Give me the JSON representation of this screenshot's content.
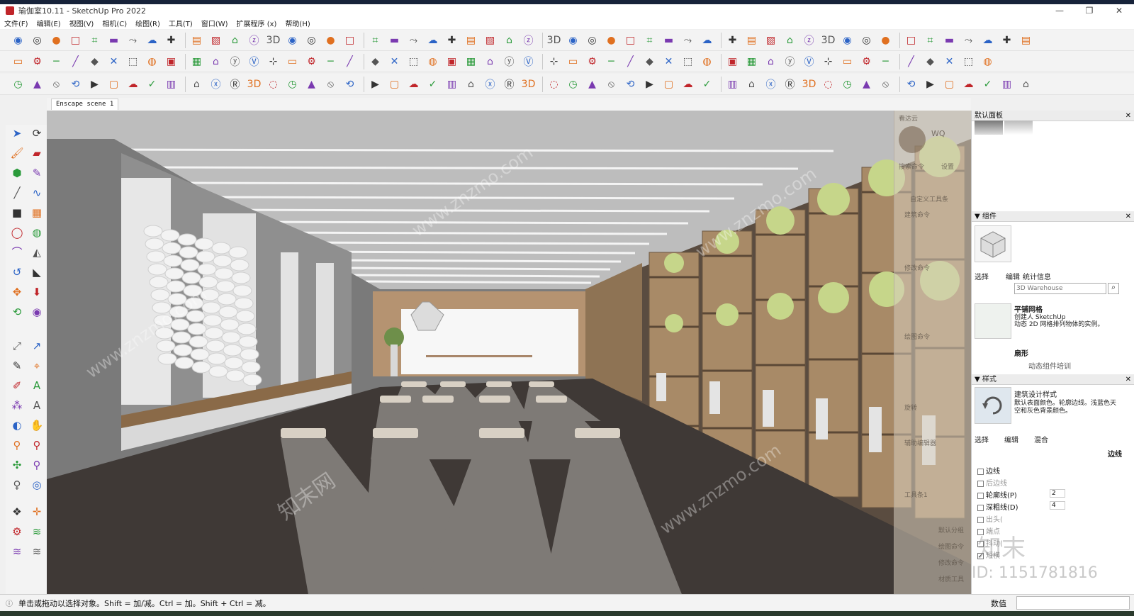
{
  "window": {
    "title": "瑜伽室10.11 - SketchUp Pro 2022"
  },
  "menu": [
    "文件(F)",
    "编辑(E)",
    "视图(V)",
    "相机(C)",
    "绘图(R)",
    "工具(T)",
    "窗口(W)",
    "扩展程序 (x)",
    "帮助(H)"
  ],
  "scene_tab": "Enscape scene 1",
  "right_panel": {
    "title": "默认面板",
    "components": {
      "header": "组件",
      "tabs": [
        "选择",
        "编辑",
        "统计信息"
      ],
      "search_placeholder": "3D Warehouse",
      "items": [
        {
          "name": "平铺网格",
          "desc1": "创建人 SketchUp",
          "desc2": "动态 2D 网格排列物体的实例。"
        },
        {
          "name": "扇形",
          "desc1": "",
          "desc2": ""
        }
      ],
      "footer": "动态组件培训"
    },
    "styles": {
      "header": "样式",
      "style_name": "建筑设计样式",
      "style_desc": "默认表面颜色。轮廓边线。浅蓝色天空和灰色背景颜色。",
      "tabs": [
        "选择",
        "编辑",
        "混合"
      ],
      "edge_label": "边线",
      "options": [
        {
          "label": "边线",
          "value": "",
          "checked": false
        },
        {
          "label": "后边线",
          "value": "",
          "checked": false
        },
        {
          "label": "轮廓线(P)",
          "value": "2",
          "checked": false
        },
        {
          "label": "深粗线(D)",
          "value": "4",
          "checked": false
        },
        {
          "label": "出头(",
          "value": "",
          "checked": false
        },
        {
          "label": "端点",
          "value": "",
          "checked": false
        },
        {
          "label": "抖动(",
          "value": "",
          "checked": false
        },
        {
          "label": "短横",
          "value": "",
          "checked": true
        }
      ]
    }
  },
  "float_panel": {
    "title": "看达云",
    "user": "WQ",
    "labels": [
      "搜索命令",
      "设置",
      "自定义工具条",
      "建筑命令",
      "修改命令",
      "绘图命令",
      "旋转",
      "辅助编辑器",
      "工具条1",
      "默认分组",
      "绘图命令",
      "修改命令",
      "材质工具"
    ]
  },
  "status": {
    "hint": "单击或拖动以选择对象。Shift = 加/减。Ctrl = 加。Shift + Ctrl = 减。",
    "value_label": "数值"
  },
  "watermarks": {
    "site": "www.znzmo.com",
    "brand": "知末网",
    "brand_short": "知末",
    "id": "ID: 1151781816"
  },
  "colors": {
    "accent": "#2b63c6",
    "floor": "#3f3936",
    "ceiling": "#bdbdbd",
    "wood": "#a07f5c",
    "ball": "#c6d68a"
  }
}
